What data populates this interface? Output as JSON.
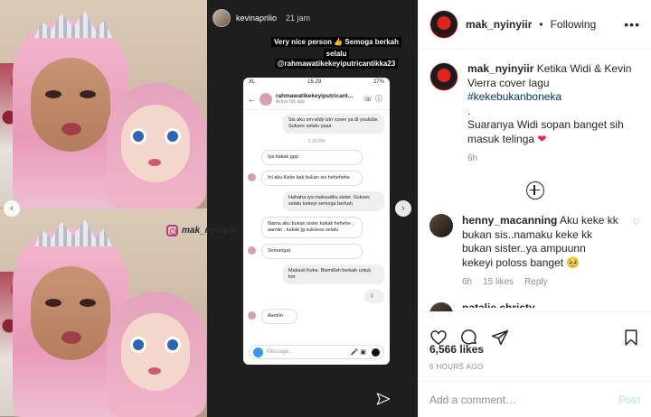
{
  "header": {
    "username": "mak_nyinyiir",
    "separator": "•",
    "follow_status": "Following",
    "more": "•••"
  },
  "caption": {
    "username": "mak_nyinyiir",
    "text_1": "Ketika Widi & Kevin Vierra cover lagu",
    "hashtag": "#kekebukanboneka",
    "dot": ".",
    "text_2": "Suaranya Widi sopan banget sih masuk telinga",
    "heart": "❤",
    "time": "6h"
  },
  "comment": {
    "username": "henny_macanning",
    "text": "Aku keke kk bukan sis..namaku keke kk bukan sister..ya ampuunn kekeyi poloss banget 🥺",
    "time": "6h",
    "likes": "15 likes",
    "reply": "Reply"
  },
  "comment2": {
    "username": "natalie.christy"
  },
  "stats": {
    "likes": "6,566 likes",
    "ago": "6 HOURS AGO"
  },
  "add_comment": {
    "placeholder": "Add a comment…",
    "post": "Post"
  },
  "media": {
    "watermark": "mak_nyinyiir",
    "story_user": "kevinaprilio",
    "story_time": "21 jam",
    "sticker_1": "Very nice person 👍 Semoga berkah",
    "sticker_2": "selalu",
    "sticker_3": "@rahmawatikekeyiputricantikka23",
    "phone_status_left": "XL",
    "phone_status_time": "15.29",
    "phone_status_right": "27%",
    "chat_name": "rahmawatikekeyiputricant...",
    "chat_active": "Active 5m ago",
    "chat_time": "1:39 PM",
    "input_placeholder": "Message...",
    "messages": [
      {
        "from": "me",
        "text": "Sis aku sm widy izin cover ya di youtube. Sukses selalu yaaa"
      },
      {
        "from": "them",
        "text": "Iya kakak gpp"
      },
      {
        "from": "them",
        "text": "Ini aku Keke kak bukan sis hehehehe"
      },
      {
        "from": "me",
        "text": "Hahaha iya maksudku sister. Sukses selalu kekeyi semoga berkah"
      },
      {
        "from": "them",
        "text": "Nama aku  bukan sister kakak hehehe , aamiin , kakak jg suksess selalu"
      },
      {
        "from": "them",
        "text": "Semangat"
      },
      {
        "from": "me",
        "text": "Makasii Keke. Bismillah berkah untuk km."
      },
      {
        "from": "me",
        "text": ":)"
      },
      {
        "from": "them",
        "text": "Aamiin"
      }
    ]
  },
  "colors": {
    "accent_link": "#00376b",
    "heart": "#e0245e",
    "post_disabled": "#b2dffc",
    "muted": "#8e8e8e"
  }
}
